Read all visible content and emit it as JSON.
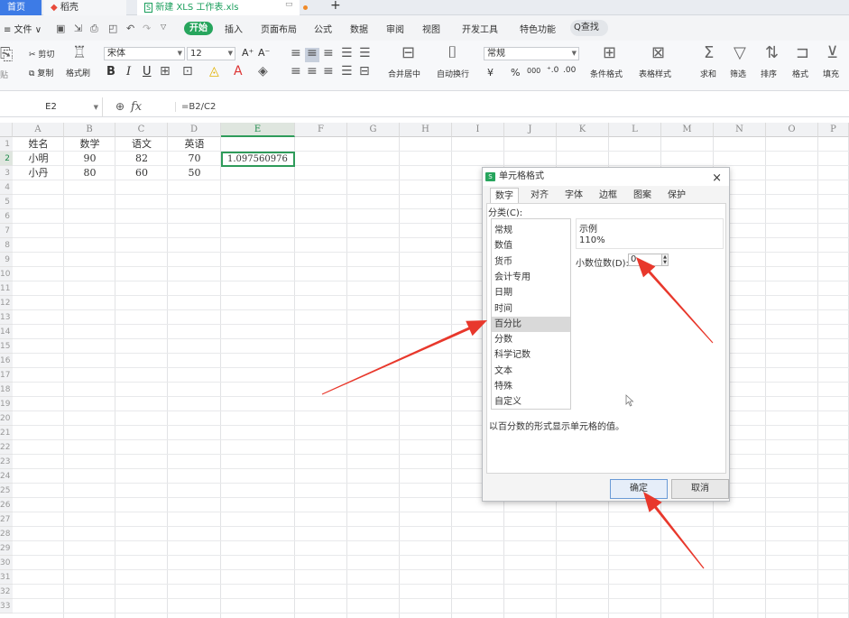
{
  "titlebar": {
    "home_tab": "首页",
    "daoke_tab": "稻壳",
    "file_tab": "新建 XLS 工作表.xls",
    "pin_icon": "pin-icon",
    "new_tab": "+"
  },
  "menu": {
    "file": "≡ 文件 ∨",
    "start": "开始",
    "items": [
      "插入",
      "页面布局",
      "公式",
      "数据",
      "审阅",
      "视图",
      "开发工具",
      "特色功能"
    ],
    "search": "Q查找"
  },
  "ribbon": {
    "paste": "贴",
    "cut": "剪切",
    "copy": "复制",
    "format_painter": "格式刷",
    "font_name": "宋体",
    "font_size": "12",
    "font_grow": "A⁺",
    "font_shrink": "A⁻",
    "bold": "B",
    "italic": "I",
    "underline": "U",
    "merge_center": "合并居中",
    "wrap": "自动换行",
    "number_format": "常规",
    "currency": "¥",
    "percent": "%",
    "thousands": "000",
    "cond_format": "条件格式",
    "table_style": "表格样式",
    "sum": "求和",
    "filter": "筛选",
    "sort": "排序",
    "format": "格式",
    "fill": "填充"
  },
  "formula_bar": {
    "name_box": "E2",
    "fx": "fx",
    "formula": "=B2/C2"
  },
  "sheet": {
    "columns": [
      "A",
      "B",
      "C",
      "D",
      "E",
      "F",
      "G",
      "H",
      "I",
      "J",
      "K",
      "L",
      "M",
      "N",
      "O",
      "P"
    ],
    "selected_column": "E",
    "rows": [
      "1",
      "2",
      "3",
      "4",
      "5",
      "6",
      "7",
      "8",
      "9",
      "10",
      "11",
      "12",
      "13",
      "14",
      "15",
      "16",
      "17",
      "18",
      "19",
      "20",
      "21",
      "22",
      "23",
      "24",
      "25",
      "26",
      "27",
      "28",
      "29",
      "30",
      "31",
      "32",
      "33"
    ],
    "data": [
      [
        "姓名",
        "数学",
        "语文",
        "英语"
      ],
      [
        "小明",
        "90",
        "82",
        "70"
      ],
      [
        "小丹",
        "80",
        "60",
        "50"
      ]
    ],
    "selected_cell_value": "1.097560976"
  },
  "dialog": {
    "title": "单元格格式",
    "close": "×",
    "tabs": [
      "数字",
      "对齐",
      "字体",
      "边框",
      "图案",
      "保护"
    ],
    "active_tab": "数字",
    "category_label": "分类(C):",
    "categories": [
      "常规",
      "数值",
      "货币",
      "会计专用",
      "日期",
      "时间",
      "百分比",
      "分数",
      "科学记数",
      "文本",
      "特殊",
      "自定义"
    ],
    "selected_category": "百分比",
    "sample_label": "示例",
    "sample_value": "110%",
    "decimal_label": "小数位数(D):",
    "decimal_value": "0",
    "description": "以百分数的形式显示单元格的值。",
    "ok": "确定",
    "cancel": "取消"
  },
  "annotation_color": "#e8382c"
}
